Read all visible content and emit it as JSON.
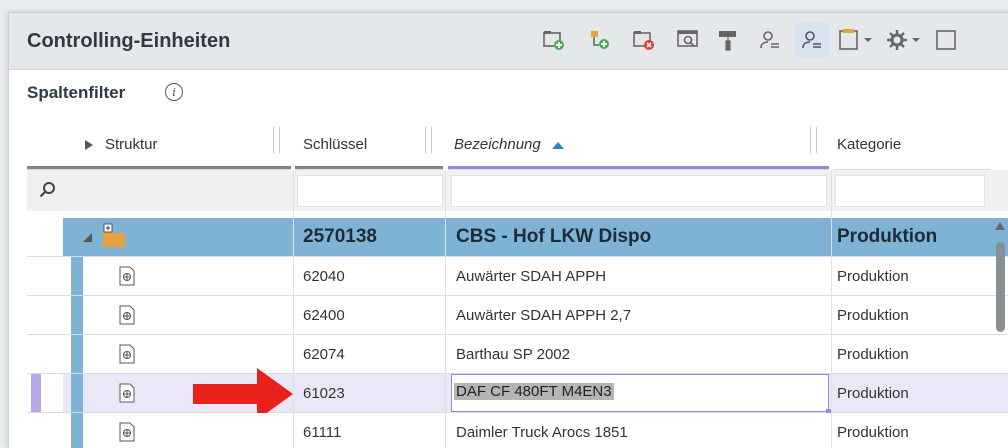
{
  "title": "Controlling-Einheiten",
  "filter_label": "Spaltenfilter",
  "info_glyph": "i",
  "toolbar": {
    "buttons": [
      "add-folder-icon",
      "add-item-icon",
      "delete-folder-icon",
      "search-window-icon",
      "paint-roller-icon",
      "person-search-icon",
      "person-filter-icon",
      "clipboard-menu-icon",
      "gear-menu-icon",
      "window-icon"
    ]
  },
  "columns": {
    "struktur": "Struktur",
    "schluessel": "Schlüssel",
    "bezeichnung": "Bezeichnung",
    "kategorie": "Kategorie"
  },
  "group_row": {
    "key": "2570138",
    "name": "CBS - Hof LKW Dispo",
    "category": "Produktion"
  },
  "rows": [
    {
      "key": "62040",
      "name": "Auwärter SDAH APPH",
      "category": "Produktion"
    },
    {
      "key": "62400",
      "name": "Auwärter SDAH APPH 2,7",
      "category": "Produktion"
    },
    {
      "key": "62074",
      "name": "Barthau SP 2002",
      "category": "Produktion"
    },
    {
      "key": "61023",
      "name": "DAF CF 480FT M4EN3",
      "category": "Produktion"
    },
    {
      "key": "61111",
      "name": "Daimler Truck Arocs 1851",
      "category": "Produktion"
    }
  ],
  "colors": {
    "accent": "#9b87d9",
    "group_bg": "#7fb3d5",
    "selected_bg": "#ece7f8",
    "arrow": "#e8221a"
  }
}
